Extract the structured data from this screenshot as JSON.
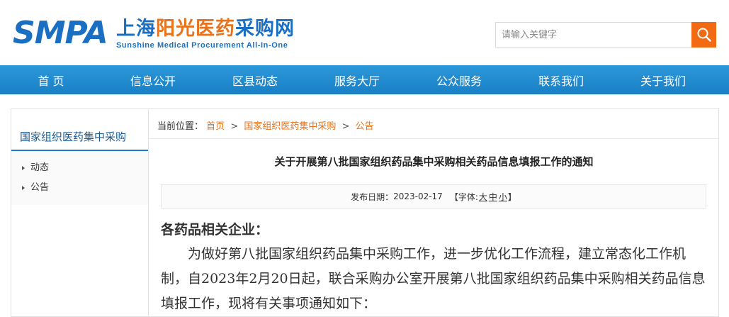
{
  "logo": {
    "smpa": "SMPA",
    "cn_part1": "上海",
    "cn_part2": "阳光医药",
    "cn_part3": "采购网",
    "en": "Sunshine Medical Procurement All-In-One"
  },
  "search": {
    "placeholder": "请输入关键字",
    "button_icon": "search-icon"
  },
  "nav": {
    "items": [
      {
        "label": "首 页"
      },
      {
        "label": "信息公开"
      },
      {
        "label": "区县动态"
      },
      {
        "label": "服务大厅"
      },
      {
        "label": "公众服务"
      },
      {
        "label": "联系我们"
      },
      {
        "label": "关于我们"
      }
    ]
  },
  "sidebar": {
    "title": "国家组织医药集中采购",
    "items": [
      {
        "label": "动态"
      },
      {
        "label": "公告"
      }
    ]
  },
  "breadcrumb": {
    "prefix": "当前位置：",
    "items": [
      "首页",
      "国家组织医药集中采购",
      "公告"
    ],
    "separator": ">"
  },
  "article": {
    "title": "关于开展第八批国家组织药品集中采购相关药品信息填报工作的通知",
    "publish_label": "发布日期：",
    "publish_date": "2023-02-17",
    "font_label": "【字体:",
    "font_large": "大",
    "font_medium": "中",
    "font_small": "小",
    "font_end": "】",
    "greeting": "各药品相关企业：",
    "paragraph": "为做好第八批国家组织药品集中采购工作，进一步优化工作流程，建立常态化工作机制，自2023年2月20日起，联合采购办公室开展第八批国家组织药品集中采购相关药品信息填报工作，现将有关事项通知如下："
  },
  "colors": {
    "brand_blue": "#1b6fc2",
    "brand_orange": "#e8731d",
    "nav_bg": "#1a7fc4",
    "search_button": "#f26b14"
  }
}
